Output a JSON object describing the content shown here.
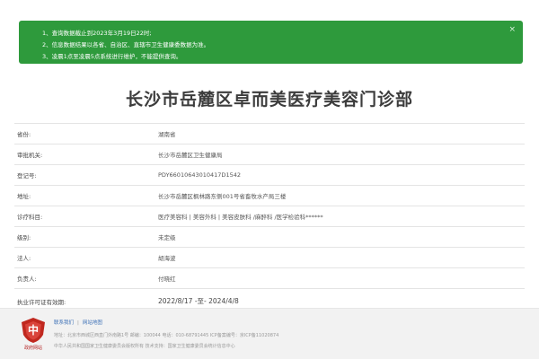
{
  "notice": {
    "lines": [
      "1、查询数据截止到2023年3月19日22时;",
      "2、信息数据结果以各省、自治区、直辖市卫生健康委数据为准。",
      "3、凌晨1点至凌晨5点系统进行维护，不能提供查询。"
    ],
    "close": "×"
  },
  "title": "长沙市岳麓区卓而美医疗美容门诊部",
  "rows": [
    {
      "label": "省份:",
      "value": "湖南省"
    },
    {
      "label": "审批机关:",
      "value": "长沙市岳麓区卫生健康局"
    },
    {
      "label": "登记号:",
      "value": "PDY66010643010417D1542"
    },
    {
      "label": "地址:",
      "value": "长沙市岳麓区枫林路东侧001号省畜牧水产局三楼"
    },
    {
      "label": "诊疗科目:",
      "value": "医疗美容科 | 美容外科 | 美容皮肤科 /麻醉科 /医学检验科******"
    },
    {
      "label": "级别:",
      "value": "未定级"
    },
    {
      "label": "法人:",
      "value": "胡海波"
    },
    {
      "label": "负责人:",
      "value": "付晓红"
    },
    {
      "label": "执业许可证有效期:",
      "value": "2022/8/17 -至- 2024/4/8"
    }
  ],
  "footer": {
    "emblem_text": "政府网站",
    "link_contact": "联系我们",
    "link_sitemap": "网站地图",
    "sep": "|",
    "address_line": "地址：北京市西城区西直门外南路1号  邮编：100044  电话：010-68791445  ICP备案编号：京ICP备11020874",
    "copyright_line": "中华人民共和国国家卫生健康委员会版权所有  技术支持：国家卫生健康委员会统计信息中心",
    "colors": {
      "emblem": "#c0281f",
      "link": "#3b6fb6"
    }
  }
}
